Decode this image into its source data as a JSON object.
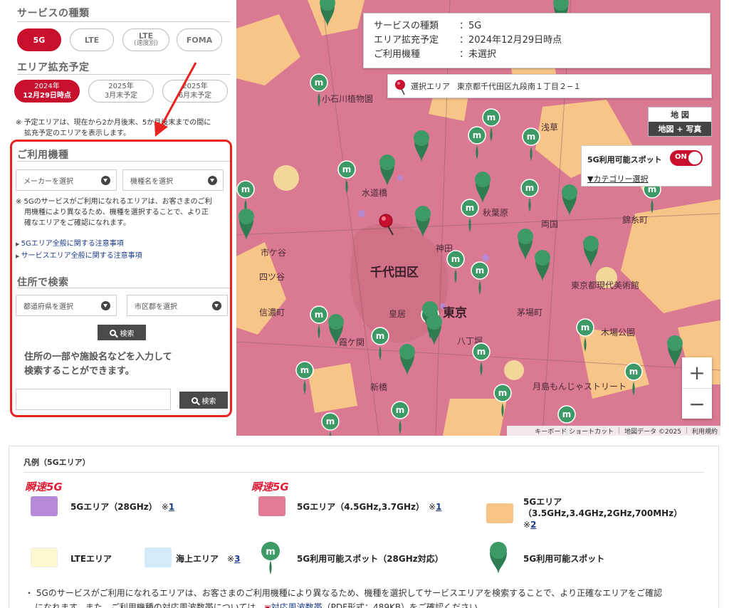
{
  "left": {
    "service_title": "サービスの種類",
    "service_buttons": [
      {
        "label": "5G",
        "sub": "",
        "active": true
      },
      {
        "label": "LTE",
        "sub": "",
        "active": false
      },
      {
        "label": "LTE",
        "sub": "(速度別)",
        "active": false
      },
      {
        "label": "FOMA",
        "sub": "",
        "active": false
      }
    ],
    "expansion_title": "エリア拡充予定",
    "expansion_buttons": [
      {
        "line1": "2024年",
        "line2": "12月29日時点",
        "active": true
      },
      {
        "line1": "2025年",
        "line2": "3月末予定",
        "active": false
      },
      {
        "line1": "2025年",
        "line2": "6月末予定",
        "active": false
      }
    ],
    "expansion_note_1": "※ 予定エリアは、現在から2か月後末、5か月後末までの間に",
    "expansion_note_2": "拡充予定のエリアを表示します。",
    "device_title": "ご利用機種",
    "maker_select": "メーカーを選択",
    "model_select": "機種名を選択",
    "device_note_1": "※ 5Gのサービスがご利用になれるエリアは、お客さまのご利",
    "device_note_2": "用機種により異なるため、機種を選択することで、より正",
    "device_note_3": "確なエリアをご確認になれます。",
    "link_1": "5Gエリア全般に関する注意事項",
    "link_2": "サービスエリア全般に関する注意事項",
    "address_title": "住所で検索",
    "pref_select": "都道府県を選択",
    "city_select": "市区郡を選択",
    "search_label": "検索",
    "free_text_1": "住所の一部や施設名などを入力して",
    "free_text_2": "検索することができます。",
    "search_label_2": "検索"
  },
  "map": {
    "info": [
      {
        "key": "サービスの種類",
        "value": "：5G"
      },
      {
        "key": "エリア拡充予定",
        "value": "：2024年12月29日時点"
      },
      {
        "key": "ご利用機種",
        "value": "：未選択"
      }
    ],
    "selected_area_label": "選択エリア",
    "selected_area_value": "東京都千代田区九段南１丁目２−１",
    "maptype_map": "地 図",
    "maptype_photo": "地図 + 写真",
    "spot_label": "5G利用可能スポット",
    "toggle_label": "ON",
    "category_link": "▼カテゴリー選択",
    "zoom_in": "+",
    "zoom_out": "−",
    "attrib_keyboard": "キーボード ショートカット",
    "attrib_data": "地図データ ©2025",
    "attrib_terms": "利用規約",
    "places": [
      {
        "name": "千代田区",
        "big": true
      },
      {
        "name": "東京",
        "big": true
      },
      {
        "name": "水道橋",
        "big": false
      },
      {
        "name": "神田",
        "big": false
      },
      {
        "name": "秋葉原",
        "big": false
      },
      {
        "name": "浅草",
        "big": false
      },
      {
        "name": "両国",
        "big": false
      },
      {
        "name": "皇居",
        "big": false
      },
      {
        "name": "霞ケ関",
        "big": false
      },
      {
        "name": "新橋",
        "big": false
      },
      {
        "name": "茅場町",
        "big": false
      },
      {
        "name": "木場公園",
        "big": false
      },
      {
        "name": "八丁堀",
        "big": false
      },
      {
        "name": "錦糸町",
        "big": false
      },
      {
        "name": "小石川植物園",
        "big": false
      },
      {
        "name": "信濃町",
        "big": false
      },
      {
        "name": "四ツ谷",
        "big": false
      },
      {
        "name": "市ケ谷",
        "big": false
      },
      {
        "name": "月島もんじゃストリート",
        "big": false
      },
      {
        "name": "東京都現代美術館",
        "big": false
      }
    ]
  },
  "legend": {
    "title": "凡例（5Gエリア）",
    "tag": "瞬速5G",
    "items": [
      {
        "label": "5Gエリア（28GHz）",
        "note": "※",
        "note_num": "1",
        "color": "#b48ad8"
      },
      {
        "label": "5Gエリア（4.5GHz,3.7GHz）",
        "note": "※",
        "note_num": "1",
        "color": "#e27c96"
      },
      {
        "label_1": "5Gエリア",
        "label_2": "（3.5GHz,3.4GHz,2GHz,700MHz）",
        "note": "※",
        "note_num": "2",
        "color": "#f7c486"
      },
      {
        "label": "LTEエリア",
        "color": "#fcf8cf"
      },
      {
        "label": "海上エリア",
        "note": "※",
        "note_num": "3",
        "color": "#d3ebf8"
      },
      {
        "label": "5G利用可能スポット（28GHz対応）"
      },
      {
        "label": "5G利用可能スポット"
      }
    ],
    "foot_1": "・ 5Gのサービスがご利用になれるエリアは、お客さまのご利用機種により異なるため、機種を選択してサービスエリアを検索することで、より正確なエリアをご確認",
    "foot_2a": "になれます。また、ご利用機種の対応周波数帯については、",
    "foot_link": "対応周波数帯",
    "foot_2b": "（PDF形式：489KB）をご確認ください。"
  },
  "colors": {
    "brand": "#c8102e",
    "highlight": "#e8231f",
    "spot_green": "#3d9a67"
  }
}
